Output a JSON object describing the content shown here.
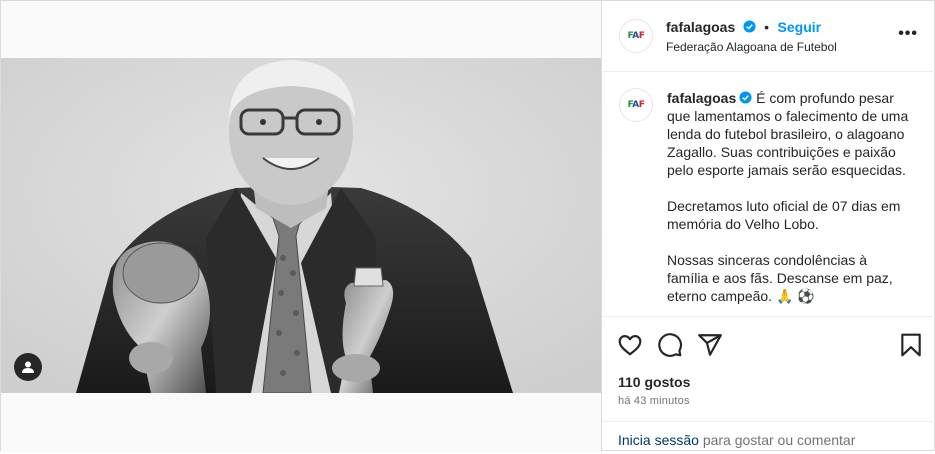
{
  "account": {
    "username": "fafalagoas",
    "follow_label": "Seguir",
    "subtitle": "Federação Alagoana de Futebol",
    "logo_text": "FAF",
    "more_label": "•••"
  },
  "caption": {
    "username": "fafalagoas",
    "paragraph1": "É com profundo pesar que lamentamos o falecimento de uma lenda do futebol brasileiro, o alagoano Zagallo. Suas contribuições e paixão pelo esporte jamais serão esquecidas.",
    "paragraph2": "Decretamos luto oficial de 07 dias em memória do Velho Lobo.",
    "paragraph3": "Nossas sinceras condolências à família e aos fãs. Descanse em paz, eterno campeão. 🙏 ⚽"
  },
  "stats": {
    "likes": "110 gostos",
    "time_ago": "há 43 minutos"
  },
  "login_prompt": {
    "link": "Inicia sessão",
    "rest": " para gostar ou comentar"
  },
  "icons": {
    "like": "heart-icon",
    "comment": "comment-icon",
    "share": "send-icon",
    "save": "bookmark-icon",
    "tag": "user-tag-icon"
  },
  "colors": {
    "link_blue": "#0095f6",
    "verified_blue": "#0095f6",
    "login_link": "#00376b",
    "muted": "#737373"
  }
}
